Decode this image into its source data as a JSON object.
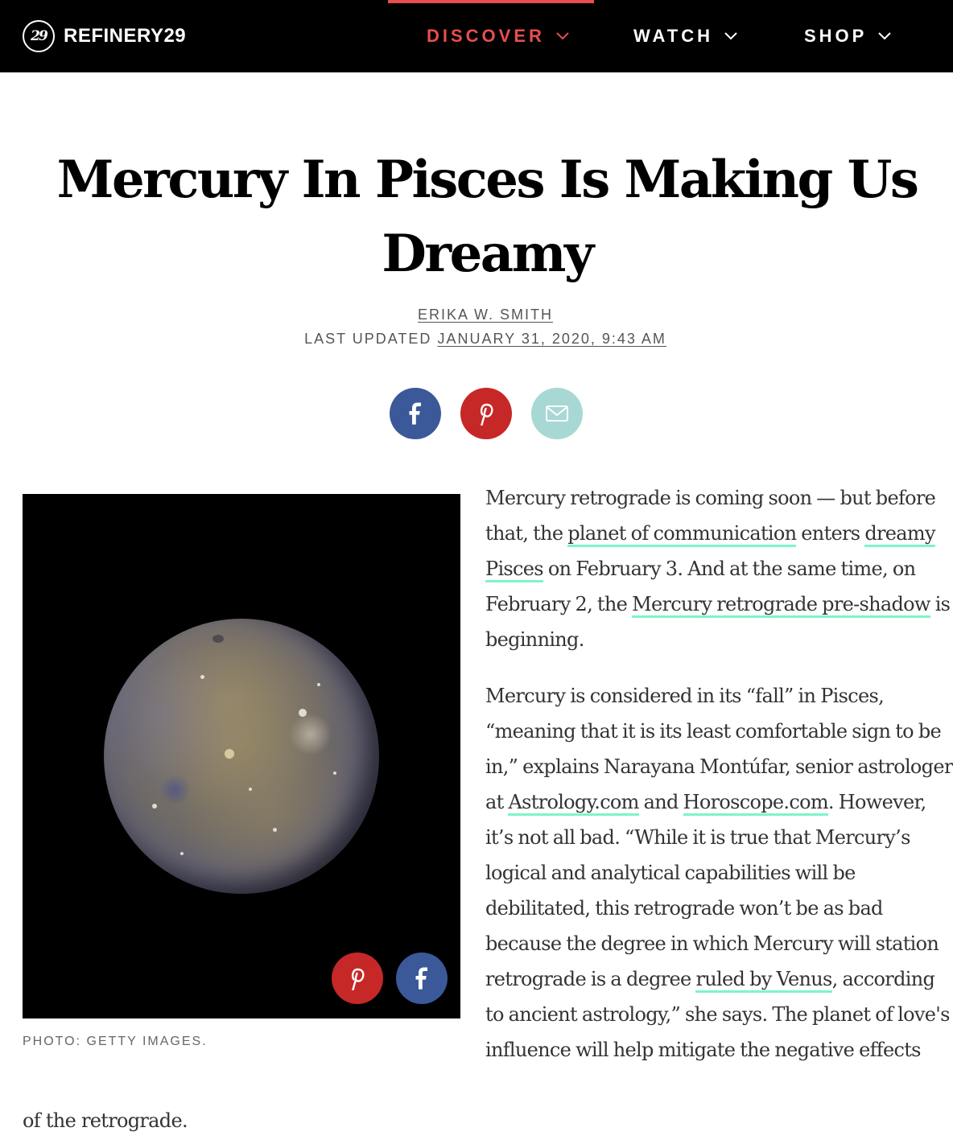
{
  "colors": {
    "header_bg": "#000000",
    "accent": "#e94e4e",
    "link_underline": "#7ef5c6",
    "facebook": "#3b5998",
    "pinterest": "#c62828",
    "email": "#a8d8d4"
  },
  "header": {
    "logo_mark": "29",
    "logo_text": "REFINERY29",
    "nav": [
      {
        "label": "DISCOVER",
        "active": true,
        "icon": "chevron-down-icon"
      },
      {
        "label": "WATCH",
        "active": false,
        "icon": "chevron-down-icon"
      },
      {
        "label": "SHOP",
        "active": false,
        "icon": "chevron-down-icon"
      }
    ]
  },
  "article": {
    "title": "Mercury In Pisces Is Making Us Dreamy",
    "author": "ERIKA W. SMITH",
    "updated_label": "LAST UPDATED",
    "updated_date": "JANUARY 31, 2020, 9:43 AM",
    "share": [
      {
        "name": "facebook",
        "icon": "facebook-icon"
      },
      {
        "name": "pinterest",
        "icon": "pinterest-icon"
      },
      {
        "name": "email",
        "icon": "mail-icon"
      }
    ],
    "photo_caption": "PHOTO: GETTY IMAGES.",
    "photo_share": [
      {
        "name": "pinterest",
        "icon": "pinterest-icon"
      },
      {
        "name": "facebook",
        "icon": "facebook-icon"
      }
    ],
    "p1": {
      "t1": "Mercury retrograde is coming soon — but before that, the ",
      "l1": "planet of communication",
      "t2": " enters ",
      "l2": "dreamy Pisces",
      "t3": " on February 3. And at the same time, on February 2, the ",
      "l3": "Mercury retrograde pre-shadow",
      "t4": " is beginning."
    },
    "p2": {
      "t1": "Mercury is considered in its “fall” in Pisces, “meaning that it is its least comfortable sign to be in,” explains Narayana Montúfar, senior astrologer at ",
      "l1": "Astrology.com",
      "t2": " and ",
      "l2": "Horoscope.com",
      "t3": ". However, it’s not all bad. “While it is true that Mercury’s logical and analytical capabilities will be debilitated, this retrograde won’t be as bad because the degree in which Mercury will station retrograde is a degree ",
      "l3": "ruled by Venus",
      "t4": ", according to ancient astrology,” she says. The planet of love's influence will help mitigate the negative effects"
    },
    "p2_tail": "of the retrograde."
  }
}
